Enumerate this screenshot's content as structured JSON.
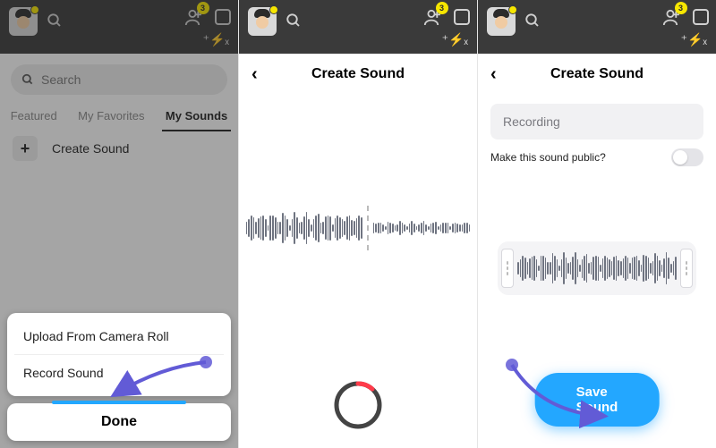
{
  "badge_count": "3",
  "panel1": {
    "search_placeholder": "Search",
    "tabs": {
      "featured": "Featured",
      "favorites": "My Favorites",
      "mysounds": "My Sounds"
    },
    "create_label": "Create Sound",
    "sheet": {
      "upload": "Upload From Camera Roll",
      "record": "Record Sound",
      "done": "Done"
    }
  },
  "panel2": {
    "title": "Create Sound"
  },
  "panel3": {
    "title": "Create Sound",
    "name_placeholder": "Recording",
    "public_label": "Make this sound public?",
    "save_label": "Save Sound"
  }
}
